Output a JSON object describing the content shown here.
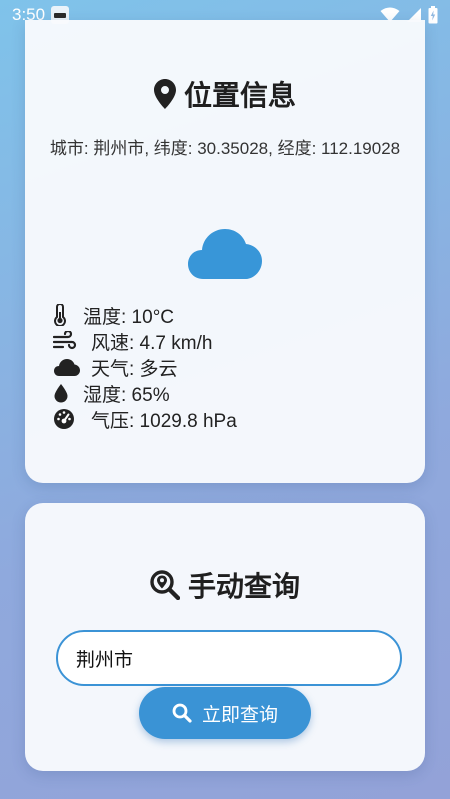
{
  "status_bar": {
    "time": "3:50"
  },
  "location_card": {
    "title": "位置信息",
    "coordinates": "城市: 荆州市, 纬度: 30.35028, 经度: 112.19028",
    "weather_icon": "cloud-icon",
    "weather_rows": [
      {
        "icon": "thermometer-icon",
        "text": "温度: 10°C"
      },
      {
        "icon": "wind-icon",
        "text": "风速: 4.7 km/h"
      },
      {
        "icon": "cloud-icon",
        "text": "天气: 多云"
      },
      {
        "icon": "droplet-icon",
        "text": "湿度: 65%"
      },
      {
        "icon": "gauge-icon",
        "text": "气压: 1029.8 hPa"
      }
    ]
  },
  "query_card": {
    "title": "手动查询",
    "title_icon": "search-location-icon",
    "input_value": "荆州市",
    "button_label": "立即查询",
    "button_icon": "search-icon"
  },
  "colors": {
    "accent": "#3a93d5",
    "cloud": "#3896d8",
    "text": "#222222"
  }
}
